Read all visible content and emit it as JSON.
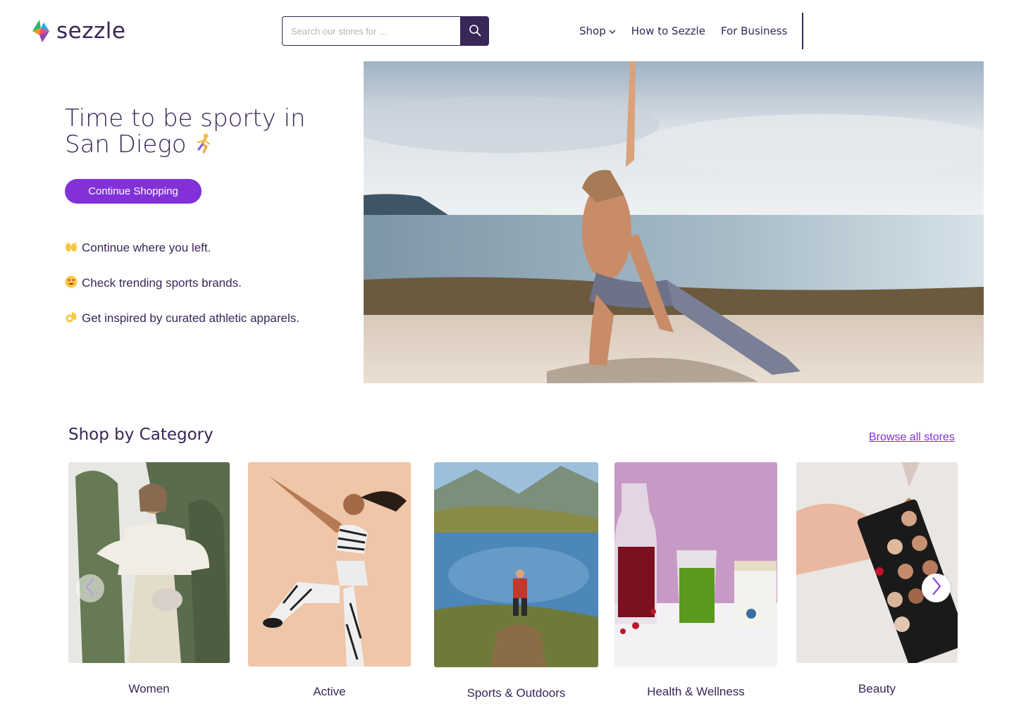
{
  "brand": {
    "name": "sezzle",
    "primary_color": "#392558",
    "accent_color": "#8230d8"
  },
  "header": {
    "search": {
      "placeholder": "Search our stores for ...",
      "icon": "search-icon"
    },
    "nav": {
      "shop": "Shop",
      "how_to": "How to Sezzle",
      "for_business": "For Business"
    }
  },
  "hero": {
    "title": "Time to be sporty in San Diego",
    "cta": "Continue Shopping",
    "bullets": [
      {
        "icon": "raised-hands-emoji",
        "text": "Continue where you left."
      },
      {
        "icon": "heart-eyes-emoji",
        "text": "Check trending sports brands."
      },
      {
        "icon": "ok-hand-emoji",
        "text": "Get inspired by curated athletic apparels."
      }
    ]
  },
  "categories": {
    "title": "Shop by Category",
    "browse_link": "Browse all stores",
    "items": [
      {
        "label": "Women"
      },
      {
        "label": "Active"
      },
      {
        "label": "Sports & Outdoors"
      },
      {
        "label": "Health & Wellness"
      },
      {
        "label": "Beauty"
      }
    ]
  }
}
